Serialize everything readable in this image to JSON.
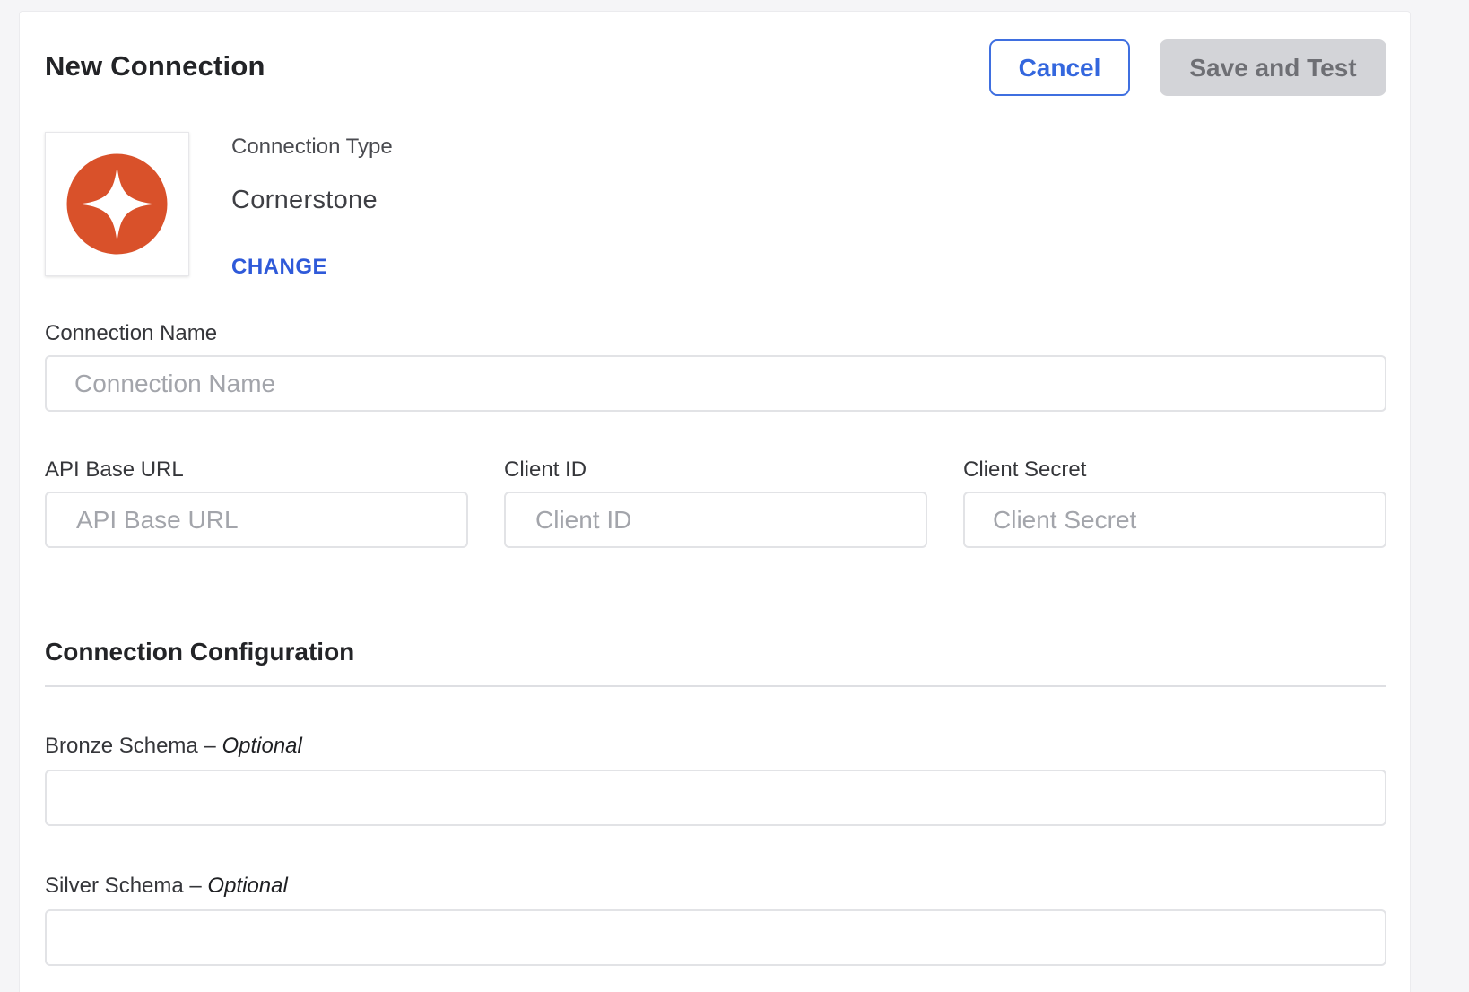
{
  "header": {
    "title": "New Connection",
    "cancel_label": "Cancel",
    "save_label": "Save and Test"
  },
  "connection_type": {
    "label": "Connection Type",
    "value": "Cornerstone",
    "change_label": "CHANGE",
    "logo_icon": "cornerstone-logo-icon",
    "logo_color": "#d9512a"
  },
  "fields": {
    "connection_name": {
      "label": "Connection Name",
      "placeholder": "Connection Name",
      "value": ""
    },
    "api_base_url": {
      "label": "API Base URL",
      "placeholder": "API Base URL",
      "value": ""
    },
    "client_id": {
      "label": "Client ID",
      "placeholder": "Client ID",
      "value": ""
    },
    "client_secret": {
      "label": "Client Secret",
      "placeholder": "Client Secret",
      "value": ""
    }
  },
  "configuration": {
    "title": "Connection Configuration",
    "bronze_schema": {
      "label": "Bronze Schema",
      "optional_sep": " – ",
      "optional": "Optional",
      "value": ""
    },
    "silver_schema": {
      "label": "Silver Schema",
      "optional_sep": " – ",
      "optional": "Optional",
      "value": ""
    }
  },
  "colors": {
    "accent": "#3467de",
    "link": "#2f5ad9",
    "disabled_button": "#d3d4d8"
  }
}
